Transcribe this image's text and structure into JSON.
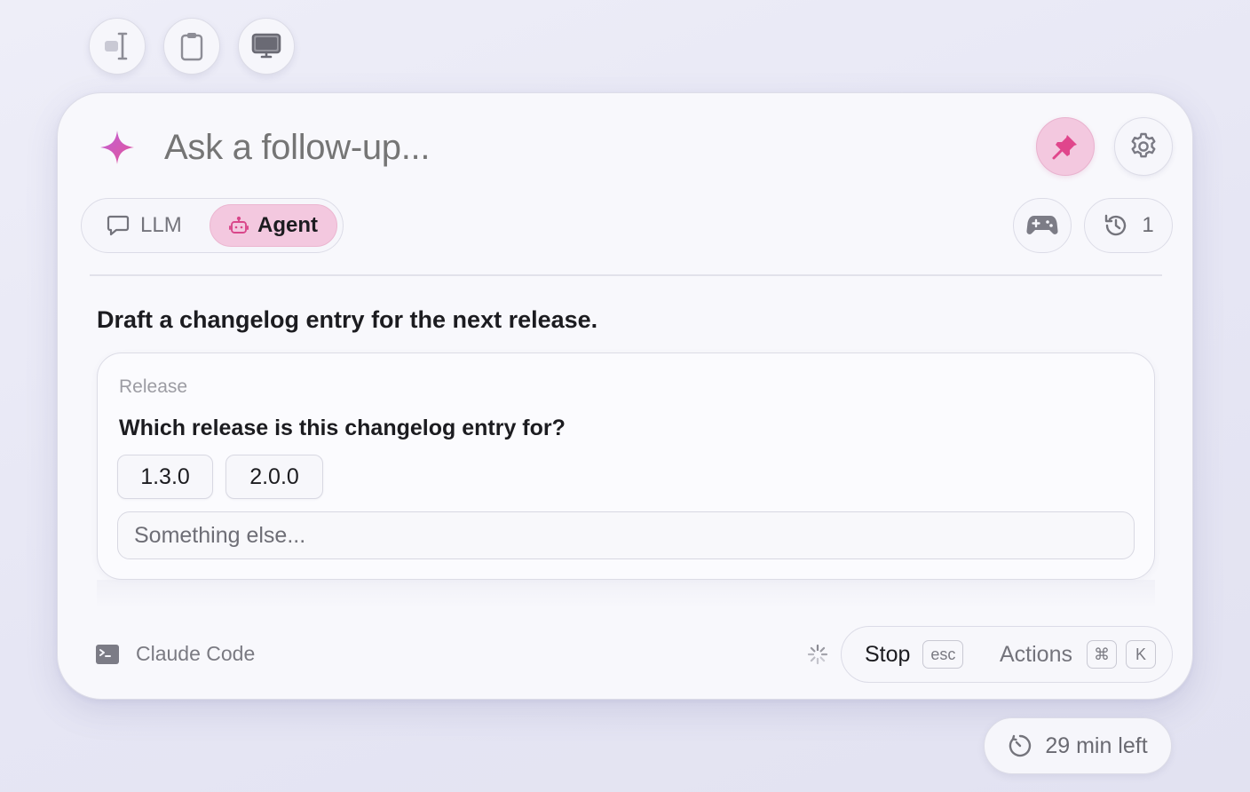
{
  "toolbar": {
    "buttons": [
      {
        "icon": "text-cursor-icon"
      },
      {
        "icon": "clipboard-icon"
      },
      {
        "icon": "monitor-icon"
      }
    ]
  },
  "prompt": {
    "placeholder": "Ask a follow-up..."
  },
  "header": {
    "pin_icon": "pin-icon",
    "settings_icon": "gear-icon",
    "accent_color": "#e0468c"
  },
  "mode": {
    "llm_label": "LLM",
    "agent_label": "Agent",
    "selected": "Agent"
  },
  "history": {
    "count": "1"
  },
  "task": {
    "title": "Draft a changelog entry for the next release."
  },
  "question_card": {
    "label": "Release",
    "question": "Which release is this changelog entry for?",
    "options": [
      "1.3.0",
      "2.0.0"
    ],
    "other_placeholder": "Something else..."
  },
  "footer": {
    "source_label": "Claude Code",
    "stop_label": "Stop",
    "stop_shortcut": "esc",
    "actions_label": "Actions",
    "actions_shortcut_mod": "⌘",
    "actions_shortcut_key": "K"
  },
  "timer": {
    "label": "29 min left"
  }
}
